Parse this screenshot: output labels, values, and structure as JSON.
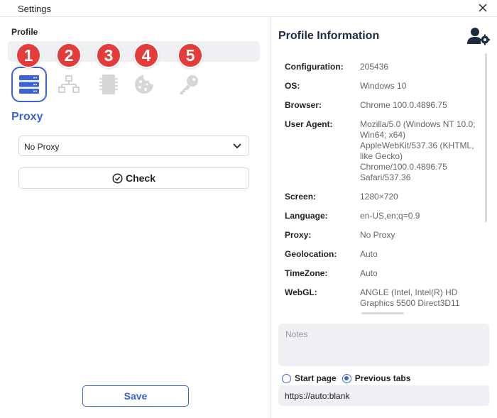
{
  "window": {
    "title": "Settings"
  },
  "left": {
    "profile_label": "Profile",
    "profile_value": "",
    "tab_badges": [
      "1",
      "2",
      "3",
      "4",
      "5"
    ],
    "section_title": "Proxy",
    "proxy_select": {
      "selected": "No Proxy"
    },
    "check_label": "Check",
    "save_label": "Save"
  },
  "right": {
    "title": "Profile Information",
    "rows": [
      {
        "key": "Configuration:",
        "value": "205436"
      },
      {
        "key": "OS:",
        "value": "Windows 10"
      },
      {
        "key": "Browser:",
        "value": "Chrome 100.0.4896.75"
      },
      {
        "key": "User Agent:",
        "value": "Mozilla/5.0 (Windows NT 10.0; Win64; x64) AppleWebKit/537.36 (KHTML, like Gecko) Chrome/100.0.4896.75 Safari/537.36"
      },
      {
        "key": "Screen:",
        "value": "1280×720"
      },
      {
        "key": "Language:",
        "value": "en-US,en;q=0.9"
      },
      {
        "key": "Proxy:",
        "value": "No Proxy"
      },
      {
        "key": "Geolocation:",
        "value": "Auto"
      },
      {
        "key": "TimeZone:",
        "value": "Auto"
      },
      {
        "key": "WebGL:",
        "value": "ANGLE (Intel, Intel(R) HD Graphics 5500 Direct3D11"
      }
    ],
    "notes_placeholder": "Notes",
    "radio_start_page": "Start page",
    "radio_previous_tabs": "Previous tabs",
    "start_url": "https://auto:blank"
  },
  "colors": {
    "accent": "#3c63d6",
    "badge": "#e43b3b",
    "field_bg": "#eef0f3"
  }
}
